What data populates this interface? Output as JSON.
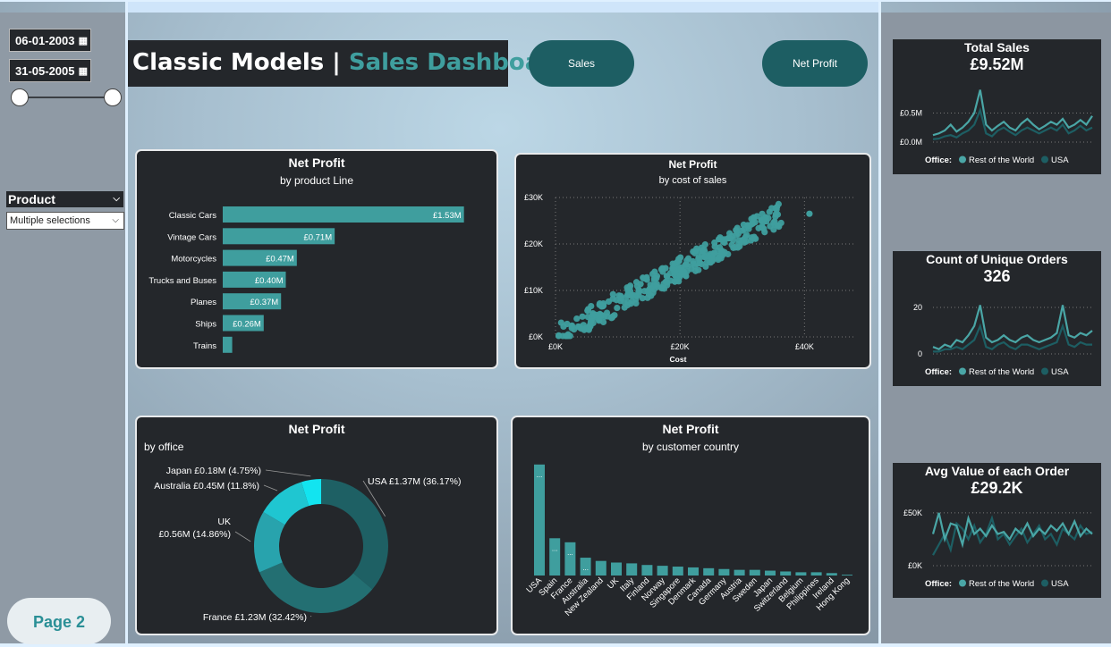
{
  "filters": {
    "start_date": "06-01-2003",
    "end_date": "31-05-2005",
    "product_label": "Product",
    "product_value": "Multiple selections",
    "calendar_icon": "calendar-icon",
    "chevron_icon": "chevron-down-icon"
  },
  "page_button": "Page 2",
  "title": {
    "part1": "Classic Models | ",
    "part2": "Sales Dashboard"
  },
  "nav": {
    "sales": "Sales",
    "net_profit": "Net Profit"
  },
  "colors": {
    "accent": "#3f9e9e",
    "dark_teal": "#1d5e63",
    "card_bg": "#24272b",
    "cyan": "#12d4e0"
  },
  "kpis": [
    {
      "title": "Total Sales",
      "value": "£9.52M",
      "ticks": [
        "£0.5M",
        "£0.0M"
      ],
      "legend_title": "Office:",
      "legend": [
        "Rest of the World",
        "USA"
      ]
    },
    {
      "title": "Count of Unique Orders",
      "value": "326",
      "ticks": [
        "20",
        "0"
      ],
      "legend_title": "Office:",
      "legend": [
        "Rest of the World",
        "USA"
      ]
    },
    {
      "title": "Avg Value of each Order",
      "value": "£29.2K",
      "ticks": [
        "£50K",
        "£0K"
      ],
      "legend_title": "Office:",
      "legend": [
        "Rest of the World",
        "USA"
      ]
    }
  ],
  "charts": {
    "product_line": {
      "title": "Net Profit",
      "subtitle": "by product Line"
    },
    "cost_scatter": {
      "title": "Net Profit",
      "subtitle": "by cost of sales"
    },
    "office_donut": {
      "title": "Net Profit",
      "subtitle": "by office"
    },
    "country_bar": {
      "title": "Net Profit",
      "subtitle": "by customer country"
    }
  },
  "chart_data": [
    {
      "type": "bar",
      "orientation": "horizontal",
      "title": "Net Profit",
      "subtitle": "by product Line",
      "categories": [
        "Classic Cars",
        "Vintage Cars",
        "Motorcycles",
        "Trucks and Buses",
        "Planes",
        "Ships",
        "Trains"
      ],
      "values": [
        1.53,
        0.71,
        0.47,
        0.4,
        0.37,
        0.26,
        0.06
      ],
      "labels": [
        "£1.53M",
        "£0.71M",
        "£0.47M",
        "£0.40M",
        "£0.37M",
        "£0.26M",
        ""
      ],
      "unit": "£M",
      "xlim": [
        0,
        1.6
      ],
      "grid": false,
      "legend": "none"
    },
    {
      "type": "scatter",
      "title": "Net Profit",
      "subtitle": "by cost of sales",
      "xlabel": "Cost",
      "ylabel": "",
      "xlim": [
        0,
        48000
      ],
      "ylim": [
        0,
        30000
      ],
      "xticks": [
        "£0K",
        "£20K",
        "£40K"
      ],
      "yticks": [
        "£0K",
        "£10K",
        "£20K",
        "£30K"
      ],
      "trend_slope": 0.73,
      "n_points": 320,
      "grid": true
    },
    {
      "type": "pie",
      "variant": "donut",
      "title": "Net Profit",
      "subtitle": "by office",
      "slices": [
        {
          "label": "USA",
          "value_text": "£1.37M (36.17%)",
          "percent": 36.17,
          "color": "#1e6064"
        },
        {
          "label": "France",
          "value_text": "£1.23M (32.42%)",
          "percent": 32.42,
          "color": "#236f72"
        },
        {
          "label": "UK",
          "value_text": "£0.56M (14.86%)",
          "percent": 14.86,
          "color": "#28a3ad"
        },
        {
          "label": "Australia",
          "value_text": "£0.45M (11.8%)",
          "percent": 11.8,
          "color": "#1fc6d1"
        },
        {
          "label": "Japan",
          "value_text": "£0.18M (4.75%)",
          "percent": 4.75,
          "color": "#12e4f0"
        }
      ]
    },
    {
      "type": "bar",
      "title": "Net Profit",
      "subtitle": "by customer country",
      "categories": [
        "USA",
        "Spain",
        "France",
        "Australia",
        "New Zealand",
        "UK",
        "Italy",
        "Finland",
        "Norway",
        "Singapore",
        "Denmark",
        "Canada",
        "Germany",
        "Austria",
        "Sweden",
        "Japan",
        "Switzerland",
        "Belgium",
        "Philippines",
        "Ireland",
        "Hong Kong"
      ],
      "values": [
        1.37,
        0.46,
        0.41,
        0.22,
        0.18,
        0.16,
        0.15,
        0.13,
        0.12,
        0.11,
        0.1,
        0.09,
        0.08,
        0.07,
        0.07,
        0.06,
        0.05,
        0.04,
        0.04,
        0.03,
        0.01
      ],
      "labels": [
        "...",
        "...",
        "...",
        "...",
        "",
        "",
        "",
        "",
        "",
        "",
        "",
        "",
        "",
        "",
        "",
        "",
        "",
        "",
        "",
        "",
        ""
      ],
      "ylim": [
        0,
        1.5
      ],
      "grid": false
    }
  ],
  "sparklines": {
    "total_sales": {
      "rest": [
        0.12,
        0.15,
        0.2,
        0.3,
        0.18,
        0.25,
        0.35,
        0.5,
        0.9,
        0.3,
        0.2,
        0.28,
        0.35,
        0.25,
        0.2,
        0.32,
        0.4,
        0.3,
        0.22,
        0.28,
        0.35,
        0.3,
        0.4,
        0.25,
        0.3,
        0.38,
        0.3,
        0.45
      ],
      "usa": [
        0.05,
        0.06,
        0.1,
        0.12,
        0.08,
        0.15,
        0.2,
        0.3,
        0.55,
        0.15,
        0.1,
        0.2,
        0.25,
        0.18,
        0.12,
        0.2,
        0.25,
        0.2,
        0.15,
        0.2,
        0.25,
        0.2,
        0.3,
        0.15,
        0.2,
        0.28,
        0.2,
        0.25
      ]
    },
    "orders": {
      "rest": [
        3,
        2,
        4,
        3,
        6,
        5,
        8,
        12,
        21,
        7,
        5,
        6,
        8,
        6,
        5,
        7,
        8,
        6,
        5,
        6,
        7,
        9,
        21,
        8,
        7,
        9,
        8,
        10
      ],
      "usa": [
        1,
        1,
        2,
        2,
        3,
        2,
        4,
        6,
        12,
        3,
        2,
        4,
        5,
        3,
        2,
        4,
        4,
        3,
        2,
        3,
        4,
        5,
        12,
        4,
        3,
        5,
        4,
        4
      ]
    },
    "avg_order": {
      "rest": [
        30,
        50,
        25,
        40,
        38,
        20,
        45,
        30,
        35,
        28,
        38,
        30,
        32,
        25,
        35,
        30,
        40,
        28,
        35,
        30,
        38,
        33,
        40,
        30,
        42,
        28,
        35,
        30
      ],
      "usa": [
        10,
        20,
        30,
        15,
        40,
        35,
        25,
        38,
        22,
        30,
        45,
        25,
        30,
        20,
        28,
        35,
        22,
        30,
        38,
        25,
        30,
        20,
        35,
        30,
        25,
        38,
        30,
        32
      ]
    }
  }
}
